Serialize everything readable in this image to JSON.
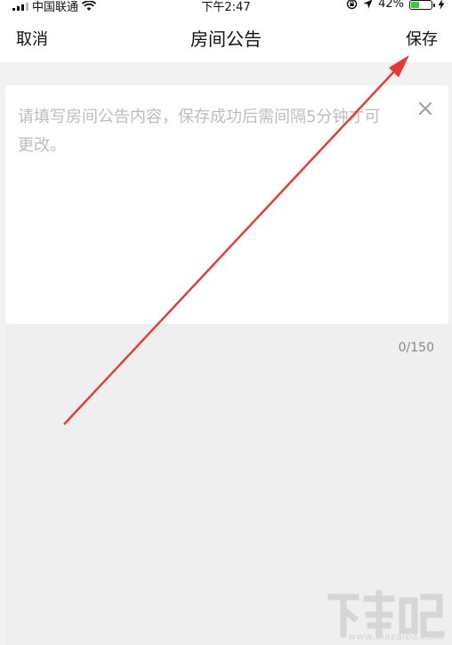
{
  "status_bar": {
    "carrier": "中国联通",
    "time": "下午2:47",
    "battery_percent": "42%",
    "battery_level": 0.42
  },
  "nav": {
    "cancel_label": "取消",
    "title": "房间公告",
    "save_label": "保存"
  },
  "editor": {
    "placeholder": "请填写房间公告内容，保存成功后需间隔5分钟才可更改。",
    "value": "",
    "clear_icon": "close-icon"
  },
  "counter": "0/150",
  "annotation": {
    "arrow_color": "#e53935",
    "points_to": "save-button"
  },
  "watermark": {
    "logo_text": "下载吧",
    "url": "www.xiazaiba.com"
  }
}
